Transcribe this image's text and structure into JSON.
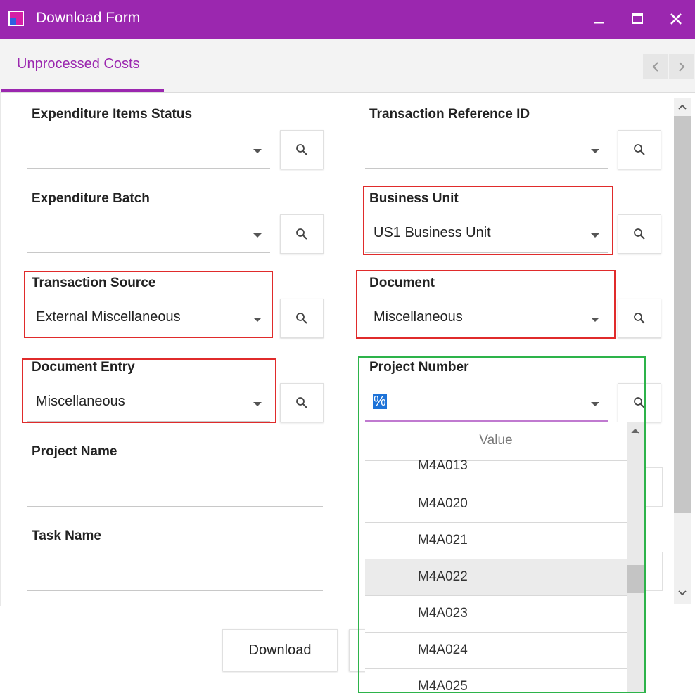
{
  "window": {
    "title": "Download Form",
    "accent_color": "#9b27af",
    "controls": {
      "minimize_icon": "minimize-icon",
      "maximize_icon": "maximize-icon",
      "close_icon": "close-icon"
    }
  },
  "tabs": {
    "active_label": "Unprocessed Costs",
    "nav": {
      "prev_icon": "chevron-left-icon",
      "next_icon": "chevron-right-icon"
    }
  },
  "form": {
    "expenditure_items_status": {
      "label": "Expenditure Items Status",
      "value": ""
    },
    "transaction_reference_id": {
      "label": "Transaction Reference ID",
      "value": ""
    },
    "expenditure_batch": {
      "label": "Expenditure Batch",
      "value": ""
    },
    "business_unit": {
      "label": "Business Unit",
      "value": "US1 Business Unit"
    },
    "transaction_source": {
      "label": "Transaction Source",
      "value": "External Miscellaneous"
    },
    "document": {
      "label": "Document",
      "value": "Miscellaneous"
    },
    "document_entry": {
      "label": "Document Entry",
      "value": "Miscellaneous"
    },
    "project_number": {
      "label": "Project Number",
      "value": "%"
    },
    "project_name": {
      "label": "Project Name",
      "value": ""
    },
    "task_name": {
      "label": "Task Name",
      "value": ""
    }
  },
  "dropdown": {
    "header": "Value",
    "items": [
      "M4A013",
      "M4A020",
      "M4A021",
      "M4A022",
      "M4A023",
      "M4A024",
      "M4A025"
    ],
    "highlighted": "M4A022"
  },
  "actions": {
    "download_label": "Download"
  },
  "colors": {
    "highlight_red": "#e02b2b",
    "highlight_green": "#2db34a",
    "focus_underline": "#c07ad0"
  }
}
